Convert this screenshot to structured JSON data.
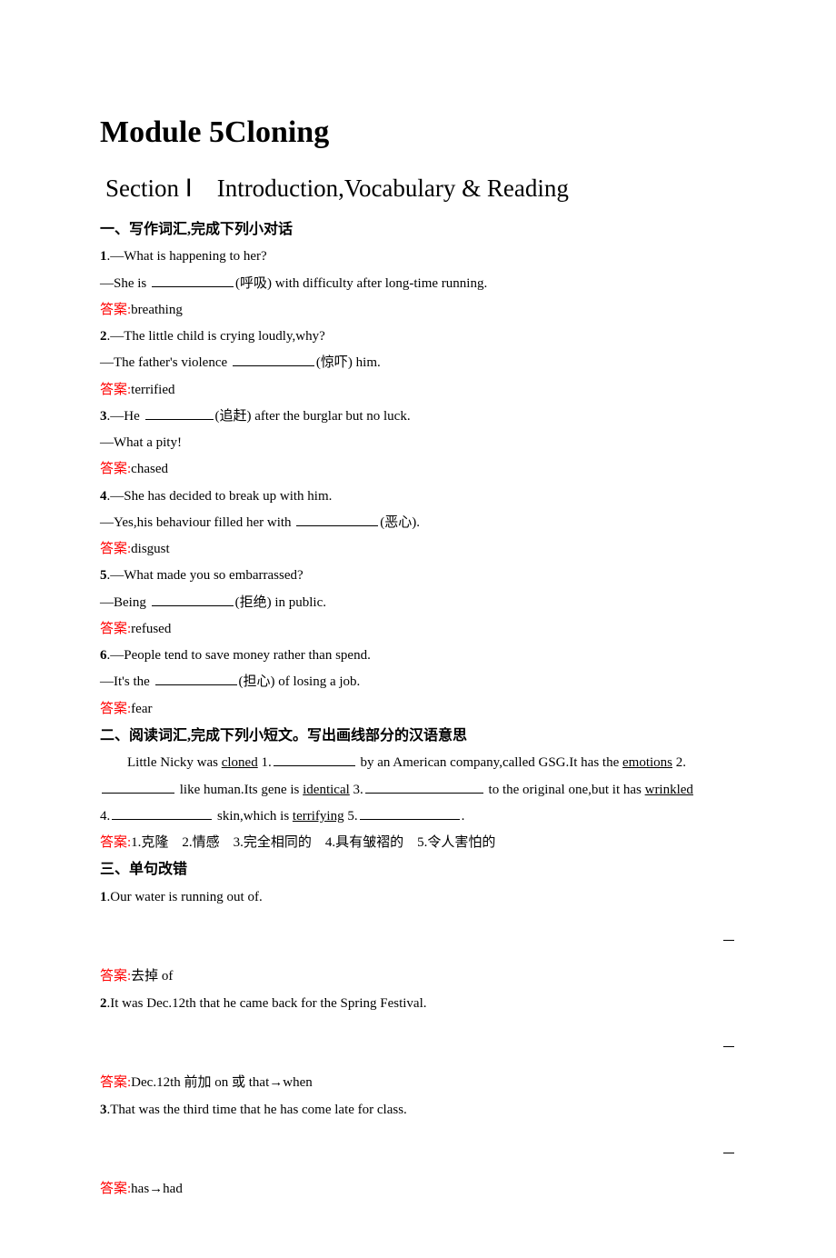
{
  "module_title": "Module 5Cloning",
  "section_title": "Section Ⅰ　Introduction,Vocabulary & Reading",
  "part1": {
    "heading": "一、写作词汇,完成下列小对话",
    "q1_num": "1",
    "q1_a": ".—What is happening to her?",
    "q1_b_pre": "—She is ",
    "q1_hint": "(呼吸)",
    "q1_b_post": " with difficulty after long-time running.",
    "a1_label": "答案:",
    "a1_val": "breathing",
    "q2_num": "2",
    "q2_a": ".—The little child is crying loudly,why?",
    "q2_b_pre": "—The father's violence ",
    "q2_hint": "(惊吓)",
    "q2_b_post": " him.",
    "a2_label": "答案:",
    "a2_val": "terrified",
    "q3_num": "3",
    "q3_a_pre": ".—He ",
    "q3_hint": "(追赶)",
    "q3_a_post": " after the burglar but no luck.",
    "q3_b": "—What a pity!",
    "a3_label": "答案:",
    "a3_val": "chased",
    "q4_num": "4",
    "q4_a": ".—She has decided to break up with him.",
    "q4_b_pre": "—Yes,his behaviour filled her with ",
    "q4_hint": "(恶心)",
    "q4_b_post": ".",
    "a4_label": "答案:",
    "a4_val": "disgust",
    "q5_num": "5",
    "q5_a": ".—What made you so embarrassed?",
    "q5_b_pre": "—Being ",
    "q5_hint": "(拒绝)",
    "q5_b_post": " in public.",
    "a5_label": "答案:",
    "a5_val": "refused",
    "q6_num": "6",
    "q6_a": ".—People tend to save money rather than spend.",
    "q6_b_pre": "—It's the ",
    "q6_hint": "(担心)",
    "q6_b_post": " of losing a job.",
    "a6_label": "答案:",
    "a6_val": "fear"
  },
  "part2": {
    "heading": "二、阅读词汇,完成下列小短文。写出画线部分的汉语意思",
    "p_seg1_pre": "Little Nicky was ",
    "p_seg1_u": "cloned",
    "p_seg1_post": " 1.",
    "p_seg2": " by an American company,called GSG.It has the ",
    "p_seg2_u": "emotions",
    "p_seg2_post": " 2.",
    "p_seg3": " like human.Its gene is ",
    "p_seg3_u": "identical",
    "p_seg3_post": " 3.",
    "p_seg4": " to the original one,but it has ",
    "p_seg4_u": "wrinkled",
    "p_seg5_pre": "4.",
    "p_seg5": " skin,which is ",
    "p_seg5_u": "terrifying",
    "p_seg5_post": " 5.",
    "p_seg6": ".",
    "a_label": "答案:",
    "a_val": "1.克隆　2.情感　3.完全相同的　4.具有皱褶的　5.令人害怕的"
  },
  "part3": {
    "heading": "三、单句改错",
    "q1_num": "1",
    "q1": ".Our water is running out of.",
    "a1_label": "答案:",
    "a1_val": "去掉 of",
    "q2_num": "2",
    "q2": ".It was Dec.12th that he came back for the Spring Festival.",
    "a2_label": "答案:",
    "a2_val": "Dec.12th 前加 on 或 that→when",
    "q3_num": "3",
    "q3": ".That was the third time that he has come late for class.",
    "a3_label": "答案:",
    "a3_val": "has→had"
  },
  "dash": "　"
}
